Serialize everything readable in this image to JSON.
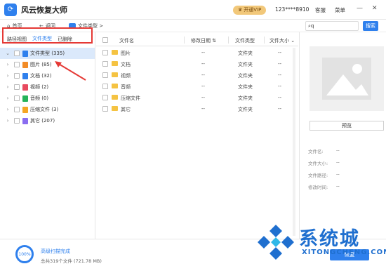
{
  "app": {
    "title": "风云恢复大师"
  },
  "titlebar": {
    "vip_label": "开通VIP",
    "user_id": "123****8910",
    "service": "客服",
    "menu": "菜单",
    "minimize": "—",
    "close": "✕"
  },
  "nav": {
    "home": "首页",
    "back": "返回",
    "path": "文件类型 >"
  },
  "left": {
    "tabs": [
      "路径视图",
      "文件类型",
      "已删除"
    ],
    "active_tab": 1,
    "tree": [
      {
        "label": "文件类型 (335)",
        "selected": true,
        "color": "#2f80ed"
      },
      {
        "label": "图片 (85)",
        "color": "#f28c28"
      },
      {
        "label": "文档 (32)",
        "color": "#2f80ed"
      },
      {
        "label": "视频 (2)",
        "color": "#e84a5f"
      },
      {
        "label": "音频 (0)",
        "color": "#25b35a"
      },
      {
        "label": "压缩文件 (3)",
        "color": "#f5a623"
      },
      {
        "label": "其它 (207)",
        "color": "#8a6df0"
      }
    ]
  },
  "table": {
    "headers": [
      "文件名",
      "修改日期",
      "文件类型",
      "文件大小"
    ],
    "rows": [
      {
        "name": "图片",
        "date": "--",
        "type": "文件夹",
        "size": "--"
      },
      {
        "name": "文档",
        "date": "--",
        "type": "文件夹",
        "size": "--"
      },
      {
        "name": "视频",
        "date": "--",
        "type": "文件夹",
        "size": "--"
      },
      {
        "name": "音频",
        "date": "--",
        "type": "文件夹",
        "size": "--"
      },
      {
        "name": "压缩文件",
        "date": "--",
        "type": "文件夹",
        "size": "--"
      },
      {
        "name": "其它",
        "date": "--",
        "type": "文件夹",
        "size": "--"
      }
    ]
  },
  "right": {
    "search_value": "q",
    "search_button": "搜索",
    "preview_button": "预览",
    "meta": [
      {
        "label": "文件名:",
        "value": "--"
      },
      {
        "label": "文件大小:",
        "value": "--"
      },
      {
        "label": "文件路径:",
        "value": "--"
      },
      {
        "label": "修改时间:",
        "value": "--"
      }
    ]
  },
  "bottom": {
    "progress": "100%",
    "status": "高级扫描完成",
    "summary": "总共319个文件 (721.78 MB)",
    "recover_button": "恢复"
  },
  "watermark": {
    "title": "系统城",
    "subtitle": "XITONGCHENG.COM"
  },
  "colors": {
    "accent": "#2f80ed",
    "highlight": "#e53935",
    "folder": "#f5c342",
    "vip": "#f2c87a"
  }
}
